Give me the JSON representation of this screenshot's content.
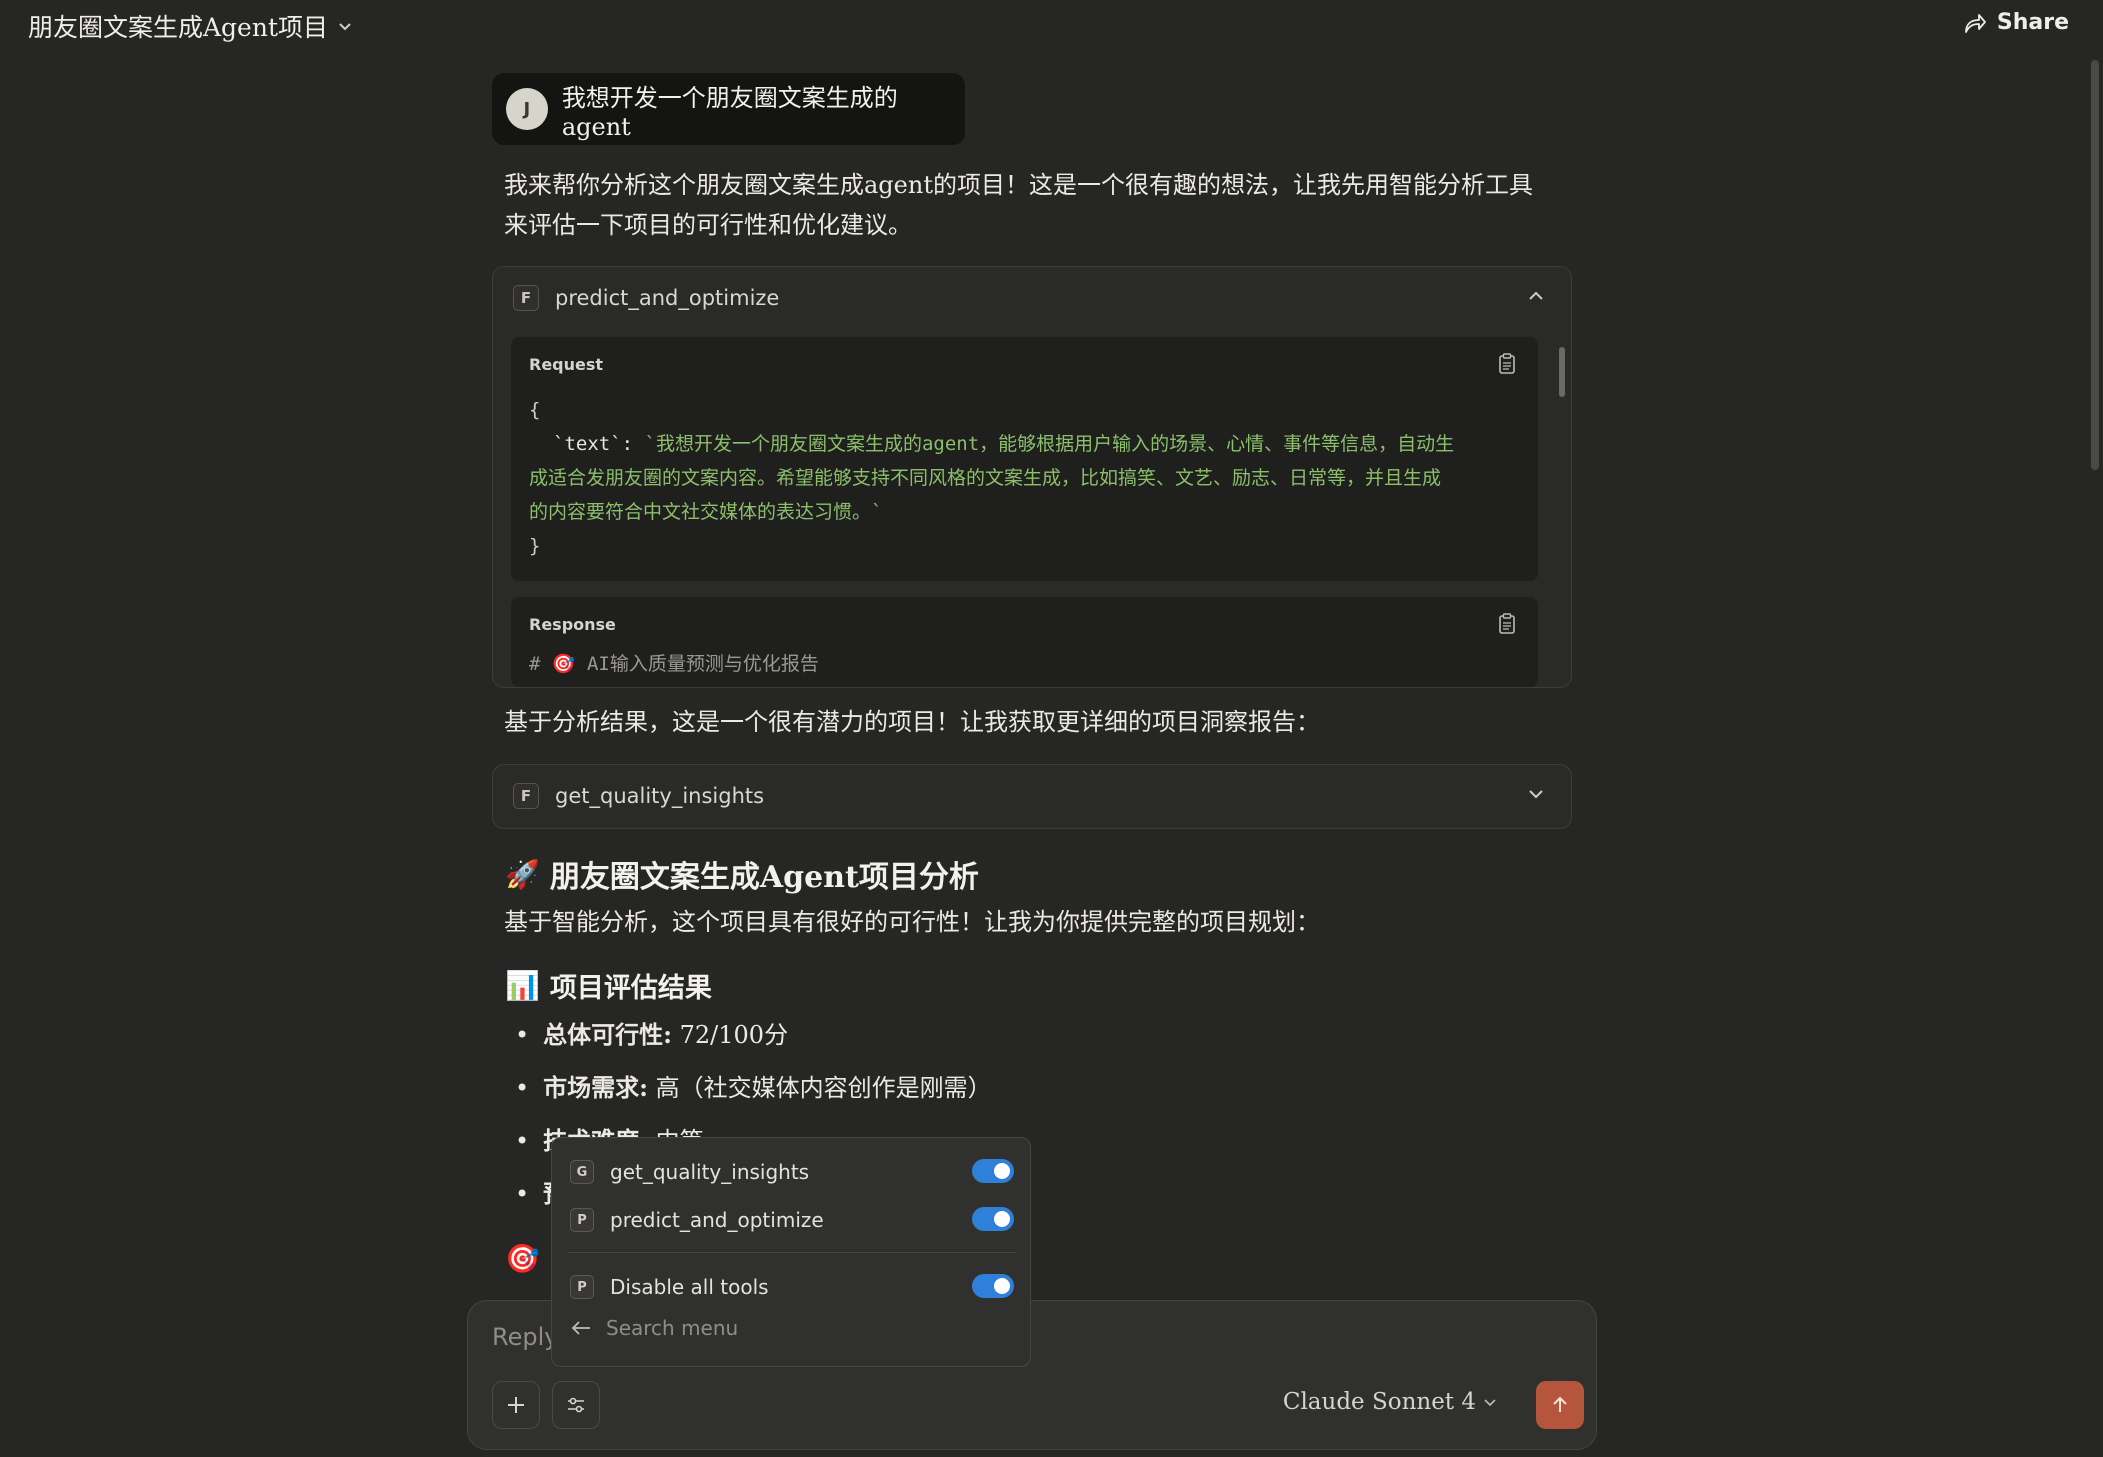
{
  "header": {
    "project_title": "朋友圈文案生成Agent项目",
    "share_label": "Share"
  },
  "user_message": {
    "avatar_initial": "J",
    "text": "我想开发一个朋友圈文案生成的agent"
  },
  "intro_lines": [
    "我来帮你分析这个朋友圈文案生成agent的项目！这是一个很有趣的想法，让我先用智能分析工具",
    "来评估一下项目的可行性和优化建议。"
  ],
  "tool_call_1": {
    "badge": "F",
    "name": "predict_and_optimize",
    "request_label": "Request",
    "request_open": "{",
    "request_key": "`text`:",
    "request_value_lines": [
      "`我想开发一个朋友圈文案生成的agent，能够根据用户输入的场景、心情、事件等信息，自动生",
      "成适合发朋友圈的文案内容。希望能够支持不同风格的文案生成，比如搞笑、文艺、励志、日常等，并且生成",
      "的内容要符合中文社交媒体的表达习惯。`"
    ],
    "request_close": "}",
    "response_label": "Response",
    "response_preview": "# 🎯 AI输入质量预测与优化报告"
  },
  "mid_text": "基于分析结果，这是一个很有潜力的项目！让我获取更详细的项目洞察报告：",
  "tool_call_2": {
    "badge": "F",
    "name": "get_quality_insights"
  },
  "analysis": {
    "title_emoji": "🚀",
    "title": "朋友圈文案生成Agent项目分析",
    "subtitle": "基于智能分析，这个项目具有很好的可行性！让我为你提供完整的项目规划：",
    "section_emoji": "📊",
    "section_title": "项目评估结果",
    "bullets": [
      {
        "label": "总体可行性:",
        "value": " 72/100分"
      },
      {
        "label": "市场需求:",
        "value": " 高（社交媒体内容创作是刚需）"
      },
      {
        "label": "技术难度:",
        "value": " 中等"
      },
      {
        "label": "预",
        "value": ""
      }
    ],
    "next_section_emoji": "🎯"
  },
  "composer": {
    "placeholder": "Reply",
    "model": "Claude Sonnet 4"
  },
  "tools_menu": {
    "items": [
      {
        "badge": "G",
        "label": "get_quality_insights",
        "enabled": true
      },
      {
        "badge": "P",
        "label": "predict_and_optimize",
        "enabled": true
      }
    ],
    "disable_all": {
      "badge": "P",
      "label": "Disable all tools",
      "enabled": true
    },
    "search_placeholder": "Search menu"
  },
  "colors": {
    "background": "#262624",
    "toggle_on": "#2f80d8",
    "send_button": "#b5553b",
    "code_string": "#8bbf6a"
  }
}
